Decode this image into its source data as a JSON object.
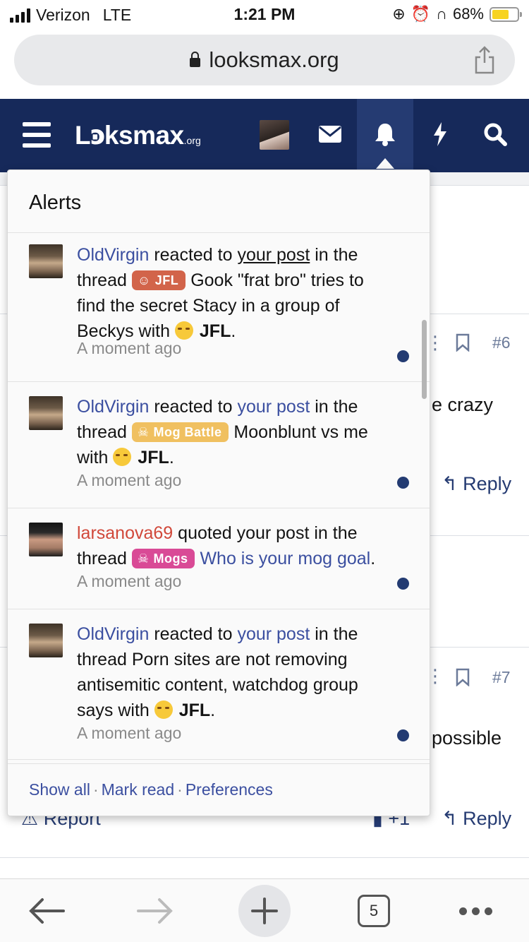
{
  "status_bar": {
    "carrier": "Verizon",
    "network": "LTE",
    "time": "1:21 PM",
    "battery": "68%",
    "battery_level": 0.68
  },
  "url_bar": {
    "domain": "looksmax.org"
  },
  "navbar": {
    "logo": "Lꜿksmax",
    "logo_suffix": ".org"
  },
  "background": {
    "post6_number": "#6",
    "post6_text": "e crazy",
    "post6_reply": "Reply",
    "post7_number": "#7",
    "post7_text": "possible",
    "post7_report": "Report",
    "post7_likes": "+1",
    "post7_reply": "Reply"
  },
  "alerts": {
    "title": "Alerts",
    "items": [
      {
        "user": "OldVirgin",
        "action": " reacted to ",
        "target": "your post",
        "mid": " in the thread ",
        "tag": "JFL",
        "thread": " Gook \"frat bro\" tries to find the secret Stacy in a group of Beckys",
        "with": " with ",
        "reaction": "JFL",
        "end": ".",
        "time": "A moment ago"
      },
      {
        "user": "OldVirgin",
        "action": " reacted to ",
        "target": "your post",
        "mid": " in the thread ",
        "tag": "Mog Battle",
        "thread": " Moonblunt vs me",
        "with": " with ",
        "reaction": "JFL",
        "end": ".",
        "time": "A moment ago"
      },
      {
        "user": "larsanova69",
        "action": " quoted your post in the thread ",
        "tag": "Mogs",
        "thread": "Who is your mog goal",
        "end": ".",
        "time": "A moment ago"
      },
      {
        "user": "OldVirgin",
        "action": " reacted to ",
        "target": "your post",
        "mid": " in the thread ",
        "thread": "Porn sites are not removing antisemitic content, watchdog group says",
        "with": " with ",
        "reaction": "JFL",
        "end": ".",
        "time": "A moment ago"
      }
    ],
    "footer": {
      "show_all": "Show all",
      "mark_read": "Mark read",
      "preferences": "Preferences",
      "separator": "·"
    }
  },
  "toolbar": {
    "tabs_count": "5"
  }
}
